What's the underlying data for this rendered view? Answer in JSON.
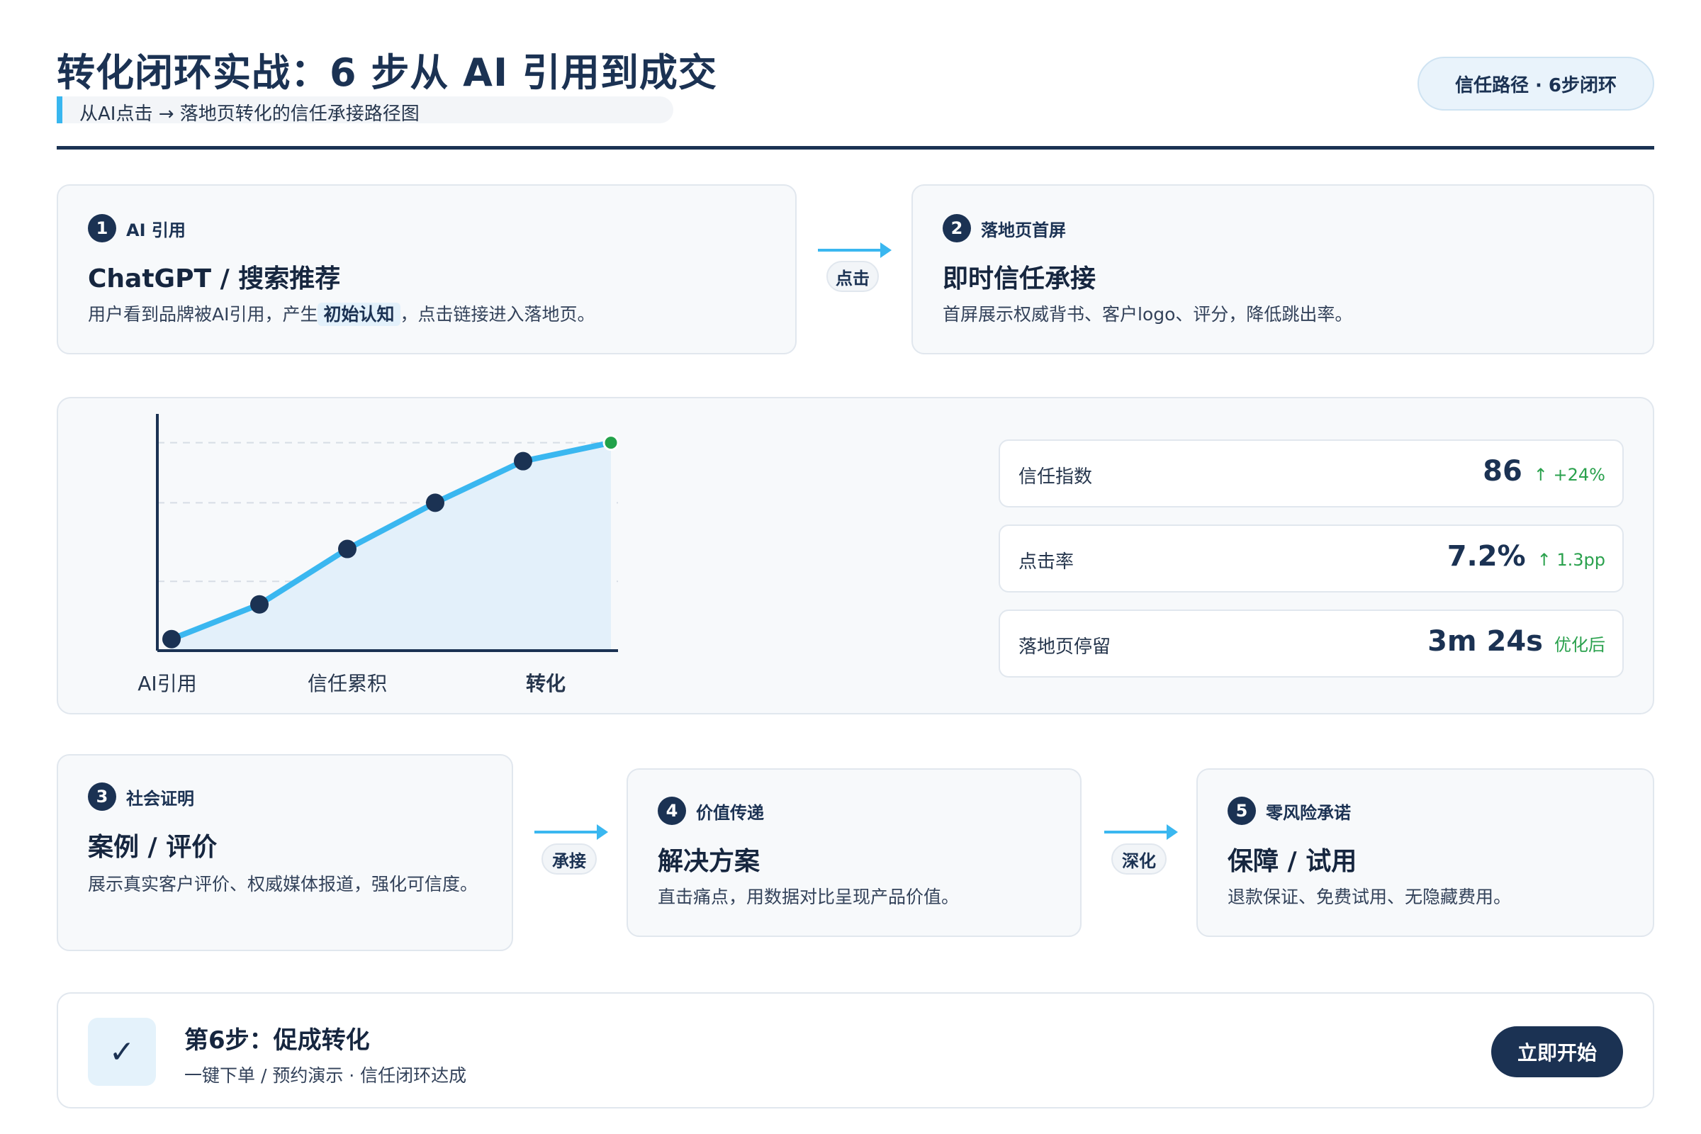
{
  "header": {
    "title": "转化闭环实战：6 步从 AI 引用到成交",
    "subtitle": "从AI点击 → 落地页转化的信任承接路径图",
    "badge": "信任路径 · 6步闭环"
  },
  "steps": [
    {
      "num": "1",
      "tag": "AI 引用",
      "title": "ChatGPT / 搜索推荐",
      "desc_before": "用户看到品牌被AI引用，产生",
      "desc_highlight": "初始认知",
      "desc_after": "，点击链接进入落地页。"
    },
    {
      "num": "2",
      "tag": "落地页首屏",
      "title": "即时信任承接",
      "desc": "首屏展示权威背书、客户logo、评分，降低跳出率。"
    },
    {
      "num": "3",
      "tag": "社会证明",
      "title": "案例 / 评价",
      "desc": "展示真实客户评价、权威媒体报道，强化可信度。"
    },
    {
      "num": "4",
      "tag": "价值传递",
      "title": "解决方案",
      "desc": "直击痛点，用数据对比呈现产品价值。"
    },
    {
      "num": "5",
      "tag": "零风险承诺",
      "title": "保障 / 试用",
      "desc": "退款保证、免费试用、无隐藏费用。"
    }
  ],
  "connectors": {
    "c1": "点击",
    "c2": "承接",
    "c3": "深化"
  },
  "chart_data": {
    "type": "line",
    "x": [
      0,
      1,
      2,
      3,
      4,
      5
    ],
    "values": [
      5,
      20,
      44,
      64,
      82,
      90
    ],
    "ylim": [
      0,
      100
    ],
    "grid": true,
    "xtick_labels": [
      "AI引用",
      "信任累积",
      "转化"
    ],
    "highlight_color": "#22a24a",
    "line_color": "#3ab7f0",
    "point_color": "#1b3253"
  },
  "metrics": [
    {
      "label": "信任指数",
      "value": "86",
      "delta": "↑ +24%"
    },
    {
      "label": "点击率",
      "value": "7.2%",
      "delta": "↑ 1.3pp"
    },
    {
      "label": "落地页停留",
      "value": "3m 24s",
      "delta": "优化后"
    }
  ],
  "final": {
    "icon": "check-icon",
    "check": "✓",
    "title": "第6步：促成转化",
    "sub": "一键下单 / 预约演示 · 信任闭环达成",
    "cta": "立即开始"
  },
  "colors": {
    "navy": "#1b3253",
    "accent": "#3ab7f0",
    "green": "#22a24a"
  }
}
